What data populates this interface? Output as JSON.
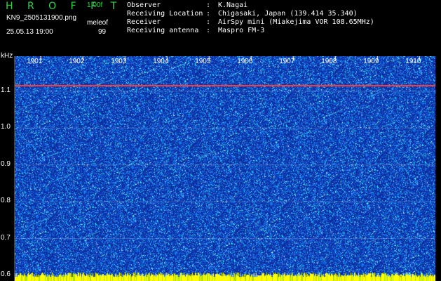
{
  "header": {
    "app_name": "H R O F F T",
    "version": "1.00f",
    "filename": "KN9_2505131900.png",
    "mode": "meleof",
    "datetime": "25.05.13 19:00",
    "gain": "99"
  },
  "info": [
    {
      "key": "Observer",
      "sep": ":",
      "value": "K.Nagai"
    },
    {
      "key": "Receiving Location",
      "sep": ":",
      "value": "Chigasaki, Japan (139.414 35.340)"
    },
    {
      "key": "Receiver",
      "sep": ":",
      "value": "AirSpy mini (Miakejima VOR 108.65MHz)"
    },
    {
      "key": "Receiving antenna",
      "sep": ":",
      "value": "Maspro FM-3"
    }
  ],
  "chart_data": {
    "type": "heatmap",
    "ylabel": "kHz",
    "yticks": [
      "1.1",
      "1.0",
      "0.9",
      "0.8",
      "0.7",
      "0.6"
    ],
    "ytick_values": [
      1.1,
      1.0,
      0.9,
      0.8,
      0.7,
      0.6
    ],
    "xticks": [
      "1901",
      "1902",
      "1903",
      "1904",
      "1905",
      "1906",
      "1907",
      "1908",
      "1909",
      "1910"
    ],
    "ylim": [
      0.585,
      1.195
    ],
    "xlim": [
      1900.38,
      1910.38
    ],
    "carrier_khz": 1.115,
    "colors": {
      "background": "#0d2d9e",
      "noise_mid": "#1a8cff",
      "noise_high": "#37e8ff",
      "noise_peak": "#b4ffe8",
      "carrier": "#ff3a3a",
      "baseline": "#ffff00"
    }
  }
}
